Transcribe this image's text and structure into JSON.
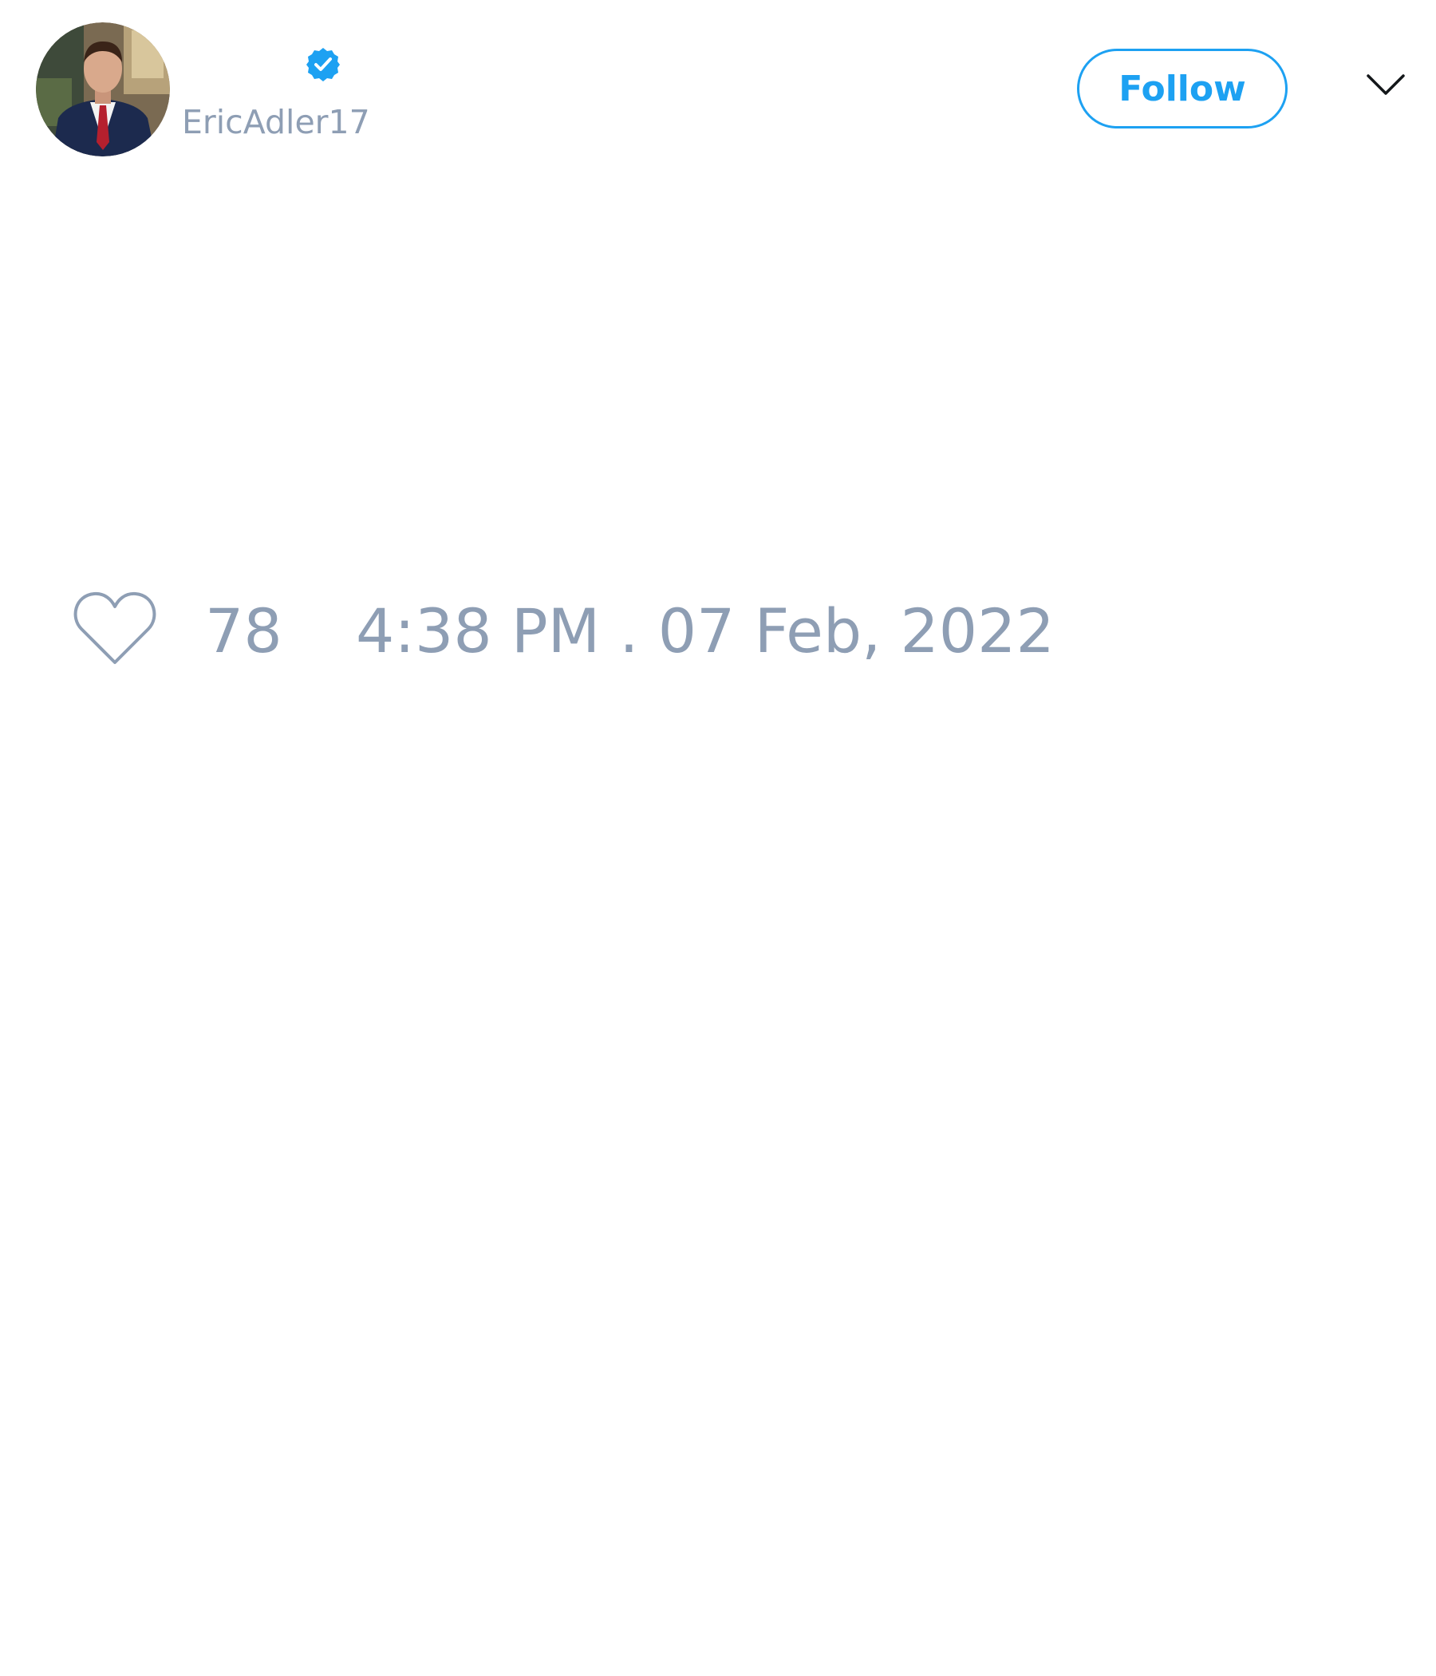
{
  "tweet": {
    "author": {
      "display_name": "",
      "handle": "EricAdler17",
      "verified": true,
      "avatar_icon": "profile-photo"
    },
    "follow_label": "Follow",
    "menu_icon": "chevron-down-icon",
    "likes": {
      "icon": "heart-icon",
      "count": "78"
    },
    "timestamp": "4:38 PM . 07 Feb, 2022"
  },
  "colors": {
    "accent": "#1da1f2",
    "muted_text": "#8e9eb4",
    "background": "#ffffff"
  }
}
